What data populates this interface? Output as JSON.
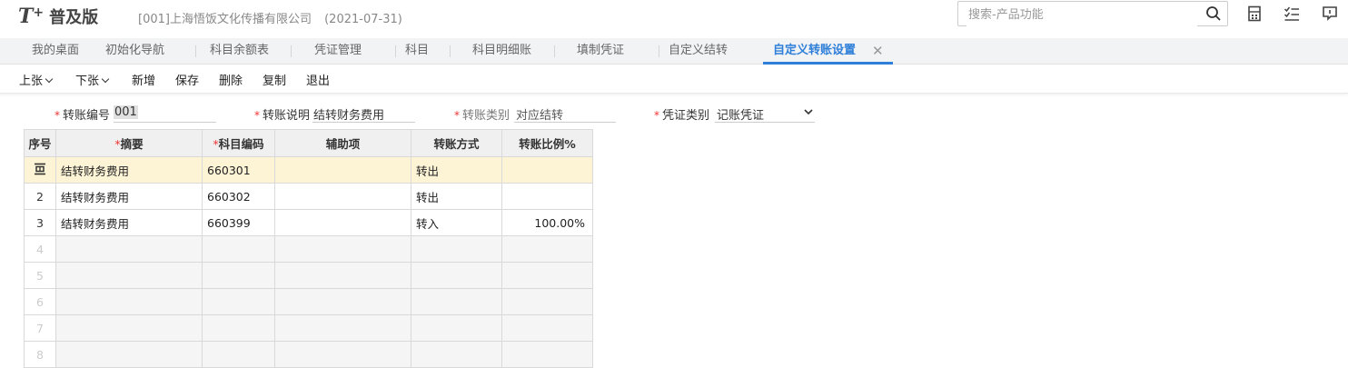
{
  "app": {
    "logo_letter": "T",
    "logo_plus": "+",
    "logo_name": "普及版",
    "company": "[001]上海悟饭文化传播有限公司",
    "date": "(2021-07-31)"
  },
  "search": {
    "placeholder": "搜索-产品功能",
    "icon": "search-icon"
  },
  "header_icons": [
    "calculator-icon",
    "checklist-icon",
    "message-icon"
  ],
  "tabs": [
    {
      "label": "我的桌面"
    },
    {
      "label": "初始化导航"
    },
    {
      "label": "科目余额表"
    },
    {
      "label": "凭证管理"
    },
    {
      "label": "科目"
    },
    {
      "label": "科目明细账"
    },
    {
      "label": "填制凭证"
    },
    {
      "label": "自定义结转"
    },
    {
      "label": "自定义转账设置",
      "active": true
    }
  ],
  "toolbar": {
    "prev": "上张",
    "next": "下张",
    "add": "新增",
    "save": "保存",
    "delete": "删除",
    "copy": "复制",
    "exit": "退出"
  },
  "form": {
    "req_mark": "*",
    "transfer_no_label": "转账编号",
    "transfer_no_value": "001",
    "description_label": "转账说明",
    "description_value": "结转财务费用",
    "transfer_type_label": "转账类别",
    "transfer_type_value": "对应结转",
    "voucher_type_label": "凭证类别",
    "voucher_type_value": "记账凭证"
  },
  "grid": {
    "headers": [
      "序号",
      "摘要",
      "科目编码",
      "辅助项",
      "转账方式",
      "转账比例%"
    ],
    "rows": [
      {
        "idx": "",
        "summary": "结转财务费用",
        "code": "660301",
        "aux": "",
        "method": "转出",
        "ratio": ""
      },
      {
        "idx": "2",
        "summary": "结转财务费用",
        "code": "660302",
        "aux": "",
        "method": "转出",
        "ratio": ""
      },
      {
        "idx": "3",
        "summary": "结转财务费用",
        "code": "660399",
        "aux": "",
        "method": "转入",
        "ratio": "100.00%"
      },
      {
        "idx": "4",
        "summary": "",
        "code": "",
        "aux": "",
        "method": "",
        "ratio": ""
      },
      {
        "idx": "5",
        "summary": "",
        "code": "",
        "aux": "",
        "method": "",
        "ratio": ""
      },
      {
        "idx": "6",
        "summary": "",
        "code": "",
        "aux": "",
        "method": "",
        "ratio": ""
      },
      {
        "idx": "7",
        "summary": "",
        "code": "",
        "aux": "",
        "method": "",
        "ratio": ""
      },
      {
        "idx": "8",
        "summary": "",
        "code": "",
        "aux": "",
        "method": "",
        "ratio": ""
      }
    ]
  },
  "colors": {
    "accent": "#2f7fd9",
    "required": "#e33333",
    "selected_row": "#fdf4d6"
  }
}
